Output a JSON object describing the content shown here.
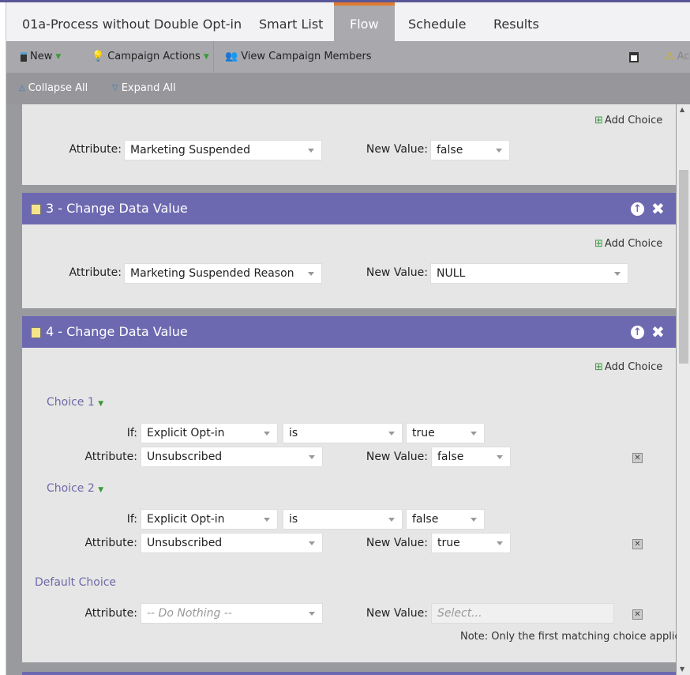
{
  "tabs": {
    "campaign": "01a-Process without Double Opt-in",
    "smart_list": "Smart List",
    "flow": "Flow",
    "schedule": "Schedule",
    "results": "Results"
  },
  "toolbar": {
    "new": "New",
    "campaign_actions": "Campaign Actions",
    "view_members": "View Campaign Members",
    "right_partial": "Ac"
  },
  "subbar": {
    "collapse": "Collapse All",
    "expand": "Expand All"
  },
  "common": {
    "add_choice": "Add Choice",
    "attribute": "Attribute:",
    "new_value": "New Value:",
    "if": "If:"
  },
  "step2": {
    "attribute": "Marketing Suspended",
    "new_value": "false"
  },
  "step3": {
    "title": "3 - Change Data Value",
    "attribute": "Marketing Suspended Reason",
    "new_value": "NULL"
  },
  "step4": {
    "title": "4 - Change Data Value",
    "choice1": {
      "label": "Choice 1",
      "if_field": "Explicit Opt-in",
      "operator": "is",
      "if_value": "true",
      "attribute": "Unsubscribed",
      "new_value": "false"
    },
    "choice2": {
      "label": "Choice 2",
      "if_field": "Explicit Opt-in",
      "operator": "is",
      "if_value": "false",
      "attribute": "Unsubscribed",
      "new_value": "true"
    },
    "default": {
      "label": "Default Choice",
      "attribute": "-- Do Nothing --",
      "new_value_placeholder": "Select..."
    },
    "note": "Note: Only the first matching choice applies"
  },
  "colors": {
    "header": "#6d69b1",
    "accent": "#e07b2f"
  }
}
